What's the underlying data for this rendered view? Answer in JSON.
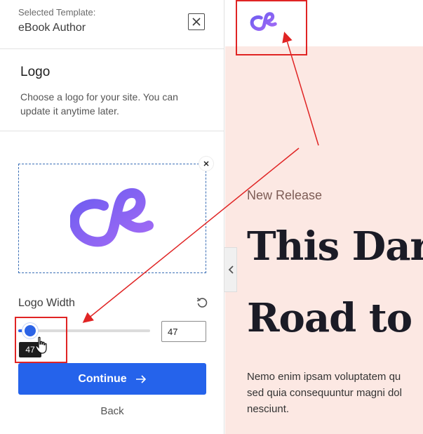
{
  "sidebar": {
    "template_label": "Selected Template:",
    "template_name": "eBook Author",
    "section_title": "Logo",
    "section_description": "Choose a logo for your site. You can update it anytime later.",
    "logo_width_label": "Logo Width",
    "logo_width_value": "47",
    "slider_tooltip": "47",
    "continue_label": "Continue",
    "back_label": "Back"
  },
  "preview": {
    "kicker": "New Release",
    "headline_line1": "This Dar",
    "headline_line2": "Road to",
    "body_line1": "Nemo enim ipsam voluptatem qu",
    "body_line2": "sed quia consequuntur magni dol",
    "body_line3": "nesciunt."
  },
  "colors": {
    "accent": "#2563eb",
    "annotation": "#e02424",
    "logo_gradient_start": "#6d5cf0",
    "logo_gradient_end": "#a36bf5",
    "hero_background": "#fce8e3"
  },
  "icons": {
    "close": "close-icon",
    "remove_logo": "close-icon",
    "reset": "reset-icon",
    "continue_arrow": "arrow-right-icon",
    "collapse": "chevron-left-icon",
    "cursor": "hand-pointer-icon"
  }
}
